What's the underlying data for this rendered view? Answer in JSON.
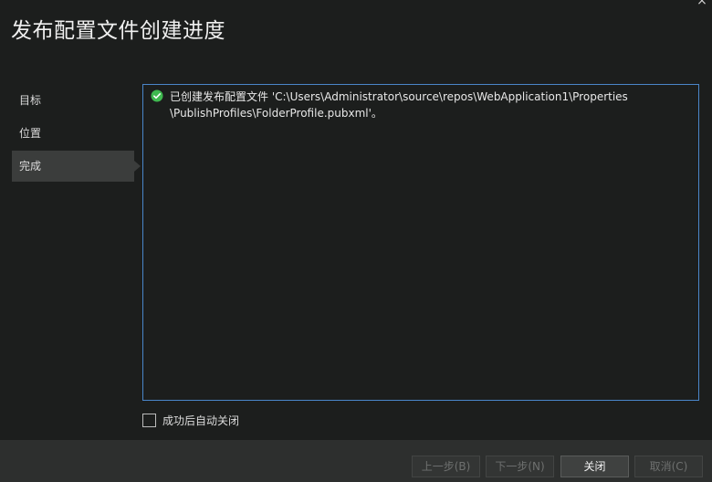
{
  "window": {
    "title": "发布配置文件创建进度",
    "close_glyph": "×"
  },
  "nav": {
    "items": [
      {
        "label": "目标",
        "active": false
      },
      {
        "label": "位置",
        "active": false
      },
      {
        "label": "完成",
        "active": true
      }
    ]
  },
  "log": {
    "entries": [
      {
        "status": "success",
        "icon": "check-circle-icon",
        "text": "已创建发布配置文件 'C:\\Users\\Administrator\\source\\repos\\WebApplication1\\Properties\\PublishProfiles\\FolderProfile.pubxml'。"
      }
    ]
  },
  "options": {
    "close_on_success_label": "成功后自动关闭",
    "close_on_success_checked": false
  },
  "footer": {
    "prev_label": "上一步(B)",
    "next_label": "下一步(N)",
    "close_label": "关闭",
    "cancel_label": "取消(C)"
  },
  "colors": {
    "background": "#1c1e1d",
    "accent_border": "#4a86c9",
    "success": "#3fb950",
    "footer": "#2d2f2e"
  }
}
